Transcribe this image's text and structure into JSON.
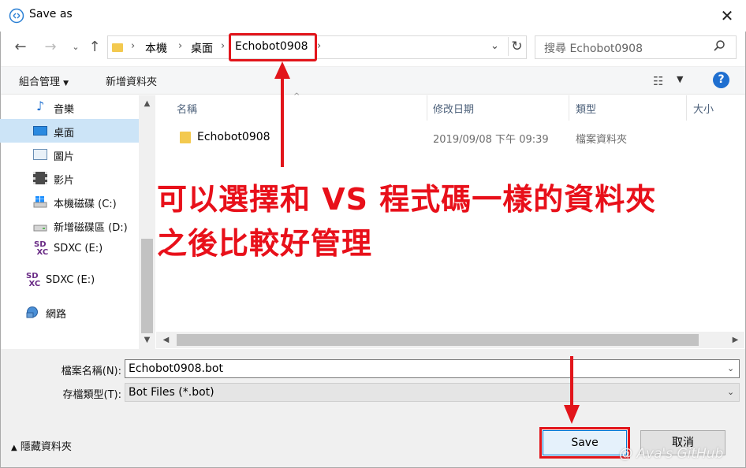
{
  "window": {
    "title": "Save as"
  },
  "address": {
    "crumbs": [
      "本機",
      "桌面",
      "Echobot0908"
    ],
    "search_placeholder": "搜尋 Echobot0908"
  },
  "toolbar": {
    "organize": "組合管理",
    "new_folder": "新增資料夾"
  },
  "sidebar": {
    "items": [
      {
        "label": "音樂",
        "icon": "music-icon"
      },
      {
        "label": "桌面",
        "icon": "desktop-icon"
      },
      {
        "label": "圖片",
        "icon": "pictures-icon"
      },
      {
        "label": "影片",
        "icon": "videos-icon"
      },
      {
        "label": "本機磁碟 (C:)",
        "icon": "windows-drive-icon"
      },
      {
        "label": "新增磁碟區 (D:)",
        "icon": "drive-icon"
      },
      {
        "label": "SDXC (E:)",
        "icon": "sd-card-icon"
      },
      {
        "label": "SDXC (E:)",
        "icon": "sd-card-icon"
      },
      {
        "label": "網路",
        "icon": "network-icon"
      }
    ]
  },
  "columns": [
    "名稱",
    "修改日期",
    "類型",
    "大小"
  ],
  "files": [
    {
      "name": "Echobot0908",
      "date": "2019/09/08 下午 09:39",
      "type": "檔案資料夾"
    }
  ],
  "annotation": {
    "line1": "可以選擇和 VS 程式碼一樣的資料夾",
    "line2": "之後比較好管理"
  },
  "form": {
    "filename_label": "檔案名稱(N):",
    "filename_value": "Echobot0908.bot",
    "filetype_label": "存檔類型(T):",
    "filetype_value": "Bot Files (*.bot)"
  },
  "footer": {
    "hide_folders": "隱藏資料夾",
    "save": "Save",
    "cancel": "取消",
    "watermark": "@ Ava's GitHub"
  },
  "colors": {
    "annotation_red": "#e2151b",
    "selected": "#cce4f7",
    "accent": "#0078d7"
  }
}
